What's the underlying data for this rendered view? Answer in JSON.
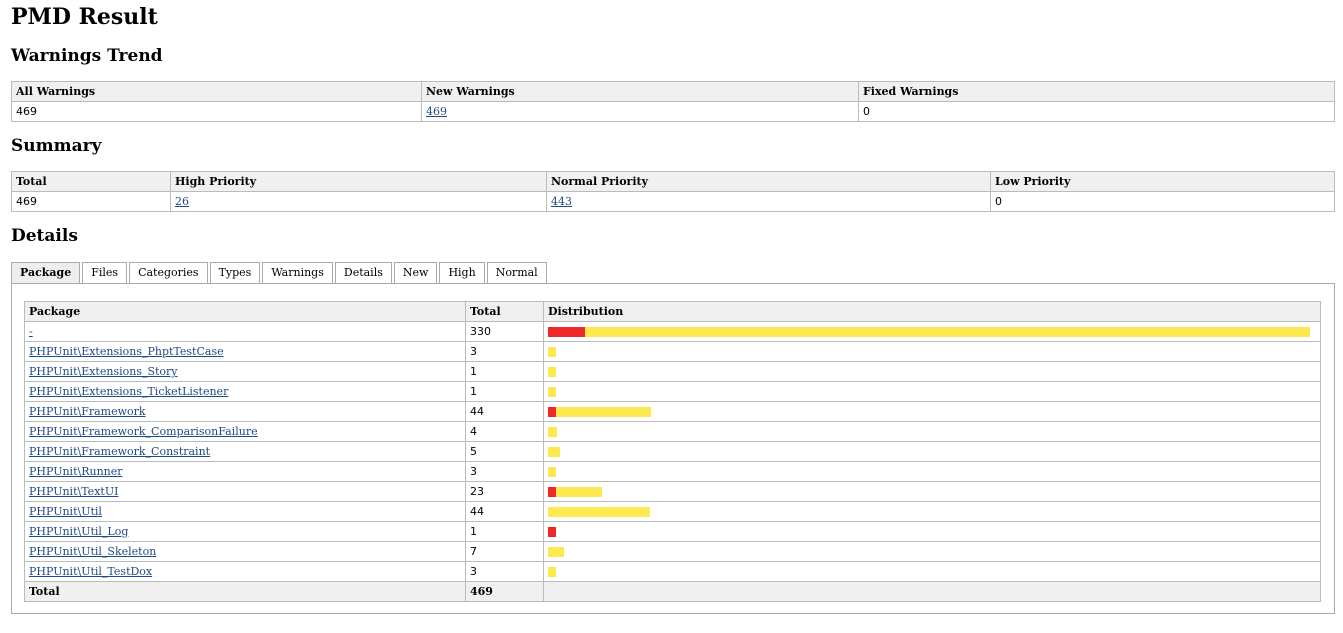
{
  "title": "PMD Result",
  "trend": {
    "heading": "Warnings Trend",
    "headers": [
      "All Warnings",
      "New Warnings",
      "Fixed Warnings"
    ],
    "all": "469",
    "new": "469",
    "fixed": "0"
  },
  "summary": {
    "heading": "Summary",
    "headers": [
      "Total",
      "High Priority",
      "Normal Priority",
      "Low Priority"
    ],
    "total": "469",
    "high": "26",
    "normal": "443",
    "low": "0"
  },
  "details": {
    "heading": "Details",
    "tabs": [
      "Package",
      "Files",
      "Categories",
      "Types",
      "Warnings",
      "Details",
      "New",
      "High",
      "Normal"
    ],
    "active_tab": 0,
    "headers": [
      "Package",
      "Total",
      "Distribution"
    ],
    "max_total": 330,
    "rows": [
      {
        "package": "-",
        "total": "330",
        "high": 16,
        "normal": 314
      },
      {
        "package": "PHPUnit\\Extensions_PhptTestCase",
        "total": "3",
        "high": 0,
        "normal": 3
      },
      {
        "package": "PHPUnit\\Extensions_Story",
        "total": "1",
        "high": 0,
        "normal": 1
      },
      {
        "package": "PHPUnit\\Extensions_TicketListener",
        "total": "1",
        "high": 0,
        "normal": 1
      },
      {
        "package": "PHPUnit\\Framework",
        "total": "44",
        "high": 3,
        "normal": 41
      },
      {
        "package": "PHPUnit\\Framework_ComparisonFailure",
        "total": "4",
        "high": 0,
        "normal": 4
      },
      {
        "package": "PHPUnit\\Framework_Constraint",
        "total": "5",
        "high": 0,
        "normal": 5
      },
      {
        "package": "PHPUnit\\Runner",
        "total": "3",
        "high": 0,
        "normal": 3
      },
      {
        "package": "PHPUnit\\TextUI",
        "total": "23",
        "high": 3,
        "normal": 20
      },
      {
        "package": "PHPUnit\\Util",
        "total": "44",
        "high": 0,
        "normal": 44
      },
      {
        "package": "PHPUnit\\Util_Log",
        "total": "1",
        "high": 1,
        "normal": 0
      },
      {
        "package": "PHPUnit\\Util_Skeleton",
        "total": "7",
        "high": 0,
        "normal": 7
      },
      {
        "package": "PHPUnit\\Util_TestDox",
        "total": "3",
        "high": 0,
        "normal": 3
      }
    ],
    "footer_label": "Total",
    "footer_total": "469"
  },
  "colors": {
    "high": "#ef2929",
    "normal": "#fce94f",
    "link": "#204a87"
  }
}
